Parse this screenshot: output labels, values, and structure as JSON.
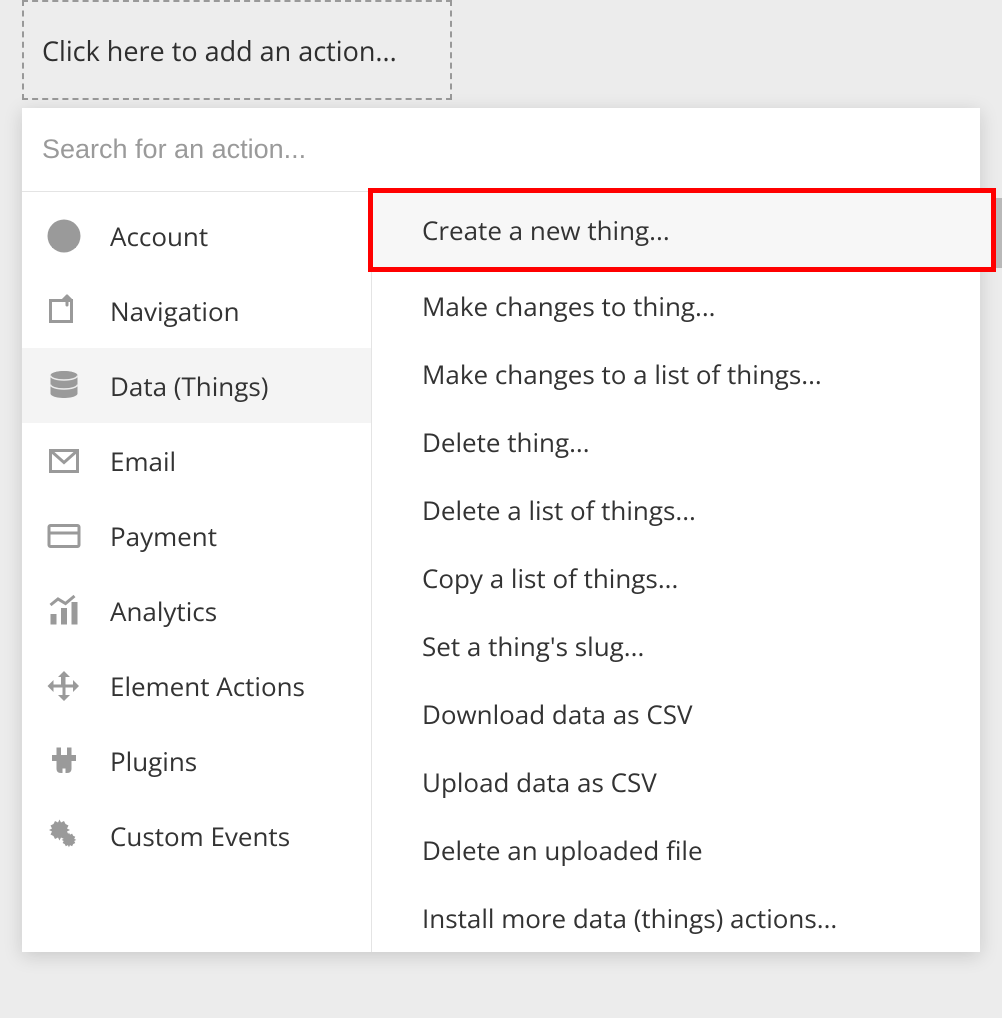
{
  "add_action_placeholder": "Click here to add an action...",
  "search_placeholder": "Search for an action...",
  "categories": [
    {
      "label": "Account",
      "icon": "account-icon",
      "selected": false
    },
    {
      "label": "Navigation",
      "icon": "navigation-icon",
      "selected": false
    },
    {
      "label": "Data (Things)",
      "icon": "database-icon",
      "selected": true
    },
    {
      "label": "Email",
      "icon": "email-icon",
      "selected": false
    },
    {
      "label": "Payment",
      "icon": "payment-icon",
      "selected": false
    },
    {
      "label": "Analytics",
      "icon": "analytics-icon",
      "selected": false
    },
    {
      "label": "Element Actions",
      "icon": "element-icon",
      "selected": false
    },
    {
      "label": "Plugins",
      "icon": "plugins-icon",
      "selected": false
    },
    {
      "label": "Custom Events",
      "icon": "gears-icon",
      "selected": false
    }
  ],
  "actions": [
    {
      "label": "Create a new thing...",
      "highlighted": true
    },
    {
      "label": "Make changes to thing...",
      "highlighted": false
    },
    {
      "label": "Make changes to a list of things...",
      "highlighted": false
    },
    {
      "label": "Delete thing...",
      "highlighted": false
    },
    {
      "label": "Delete a list of things...",
      "highlighted": false
    },
    {
      "label": "Copy a list of things...",
      "highlighted": false
    },
    {
      "label": "Set a thing's slug...",
      "highlighted": false
    },
    {
      "label": "Download data as CSV",
      "highlighted": false
    },
    {
      "label": "Upload data as CSV",
      "highlighted": false
    },
    {
      "label": "Delete an uploaded file",
      "highlighted": false
    },
    {
      "label": "Install more data (things) actions...",
      "highlighted": false
    }
  ]
}
